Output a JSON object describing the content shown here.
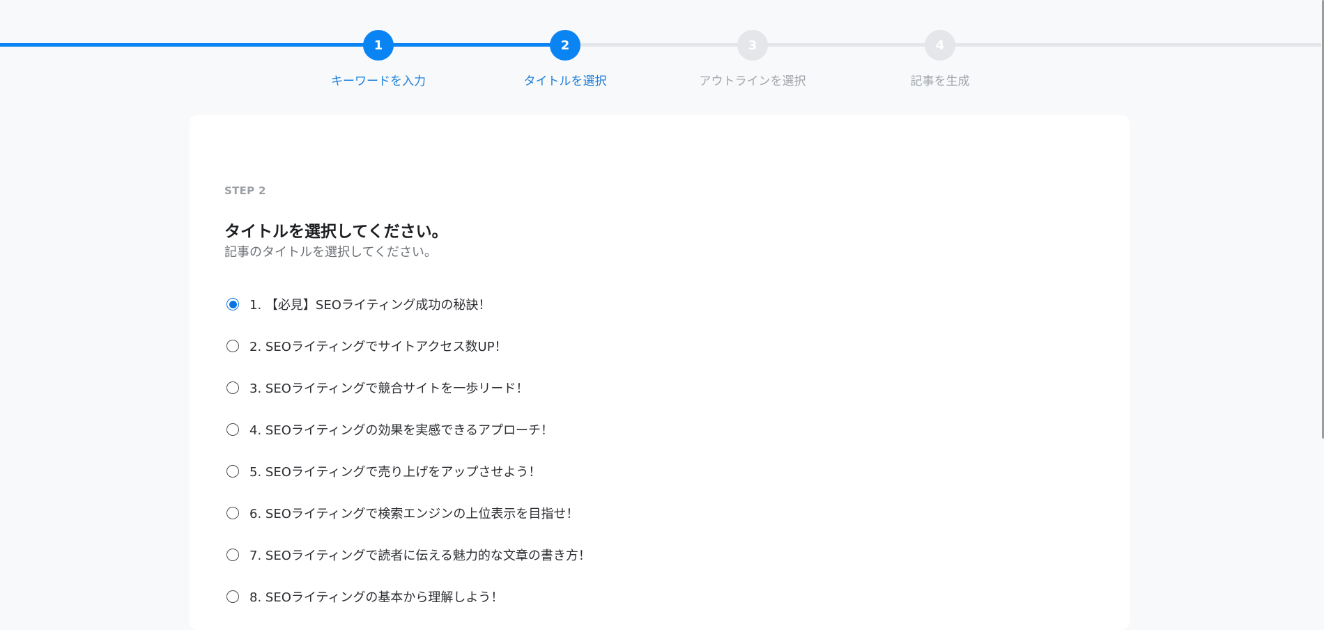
{
  "stepper": {
    "steps": [
      {
        "number": "1",
        "label": "キーワードを入力",
        "state": "completed"
      },
      {
        "number": "2",
        "label": "タイトルを選択",
        "state": "current"
      },
      {
        "number": "3",
        "label": "アウトラインを選択",
        "state": "upcoming"
      },
      {
        "number": "4",
        "label": "記事を生成",
        "state": "upcoming"
      }
    ]
  },
  "card": {
    "step_label": "STEP 2",
    "title": "タイトルを選択してください。",
    "subtitle": "記事のタイトルを選択してください。",
    "selected_index": 0,
    "options": [
      "1. 【必見】SEOライティング成功の秘訣！",
      "2. SEOライティングでサイトアクセス数UP！",
      "3. SEOライティングで競合サイトを一歩リード！",
      "4. SEOライティングの効果を実感できるアプローチ！",
      "5. SEOライティングで売り上げをアップさせよう！",
      "6. SEOライティングで検索エンジンの上位表示を目指せ！",
      "7. SEOライティングで読者に伝える魅力的な文章の書き方！",
      "8. SEOライティングの基本から理解しよう！"
    ]
  },
  "colors": {
    "accent": "#0b84f3",
    "inactive": "#e4e6e9",
    "page_background": "#f8f9fa"
  }
}
